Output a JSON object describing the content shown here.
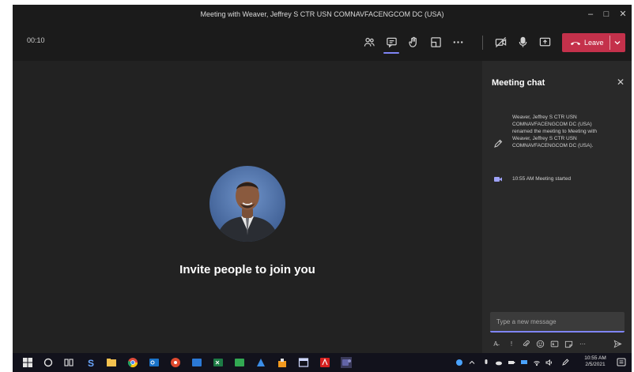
{
  "window": {
    "title": "Meeting with Weaver, Jeffrey S CTR USN COMNAVFACENGCOM DC (USA)"
  },
  "controls": {
    "timer": "00:10",
    "leave_label": "Leave",
    "leave_color": "#c4314b",
    "active_accent": "#7f85f5",
    "buttons": [
      "people-icon",
      "chat-icon",
      "raise-hand-icon",
      "breakout-icon",
      "more-icon",
      "camera-off-icon",
      "mic-icon",
      "share-screen-icon"
    ]
  },
  "stage": {
    "invite_text": "Invite people to join you"
  },
  "chat": {
    "title": "Meeting chat",
    "events": [
      {
        "icon": "pencil-icon",
        "text": "Weaver, Jeffrey S CTR USN COMNAVFACENGCOM DC (USA) renamed the meeting to Meeting with Weaver, Jeffrey S CTR USN COMNAVFACENGCOM DC (USA)."
      },
      {
        "icon": "video-icon",
        "text": "10:55 AM   Meeting started"
      }
    ],
    "input_placeholder": "Type a new message"
  },
  "taskbar": {
    "time": "10:55 AM",
    "date": "2/5/2021"
  }
}
